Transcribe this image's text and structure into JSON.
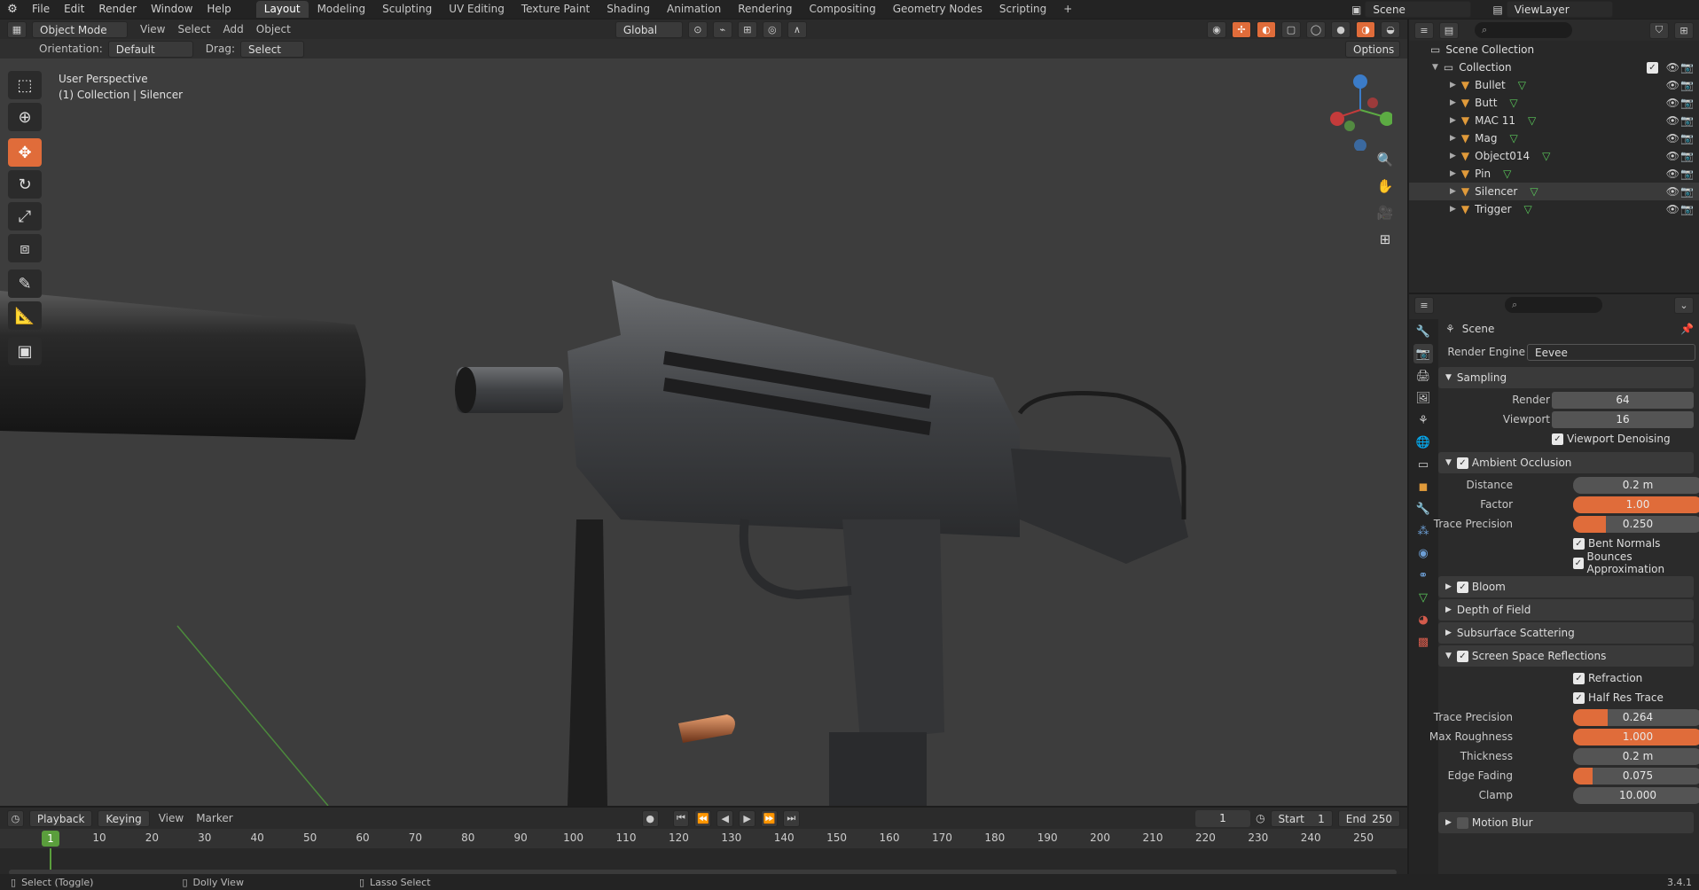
{
  "topbar": {
    "menus": [
      "File",
      "Edit",
      "Render",
      "Window",
      "Help"
    ],
    "workspaces": [
      "Layout",
      "Modeling",
      "Sculpting",
      "UV Editing",
      "Texture Paint",
      "Shading",
      "Animation",
      "Rendering",
      "Compositing",
      "Geometry Nodes",
      "Scripting"
    ],
    "active_workspace": "Layout",
    "scene_name": "Scene",
    "view_layer": "ViewLayer"
  },
  "viewport_header": {
    "mode": "Object Mode",
    "menus": [
      "View",
      "Select",
      "Add",
      "Object"
    ],
    "transform": "Global",
    "options": "Options"
  },
  "tool_settings": {
    "orientation_label": "Orientation:",
    "orientation_value": "Default",
    "drag_label": "Drag:",
    "drag_value": "Select Box"
  },
  "viewport": {
    "perspective": "User Perspective",
    "collection_info": "(1) Collection | Silencer"
  },
  "outliner": {
    "root": "Scene Collection",
    "collection": "Collection",
    "objects": [
      "Bullet",
      "Butt",
      "MAC 11",
      "Mag",
      "Object014",
      "Pin",
      "Silencer",
      "Trigger"
    ],
    "selected": "Silencer"
  },
  "properties": {
    "context": "Scene",
    "render_engine_label": "Render Engine",
    "render_engine": "Eevee",
    "sampling": {
      "title": "Sampling",
      "render_label": "Render",
      "render": "64",
      "viewport_label": "Viewport",
      "viewport": "16",
      "denoise": "Viewport Denoising"
    },
    "ao": {
      "title": "Ambient Occlusion",
      "distance_label": "Distance",
      "distance": "0.2 m",
      "factor_label": "Factor",
      "factor": "1.00",
      "factor_fill": 1.0,
      "trace_label": "Trace Precision",
      "trace": "0.250",
      "trace_fill": 0.25,
      "bent": "Bent Normals",
      "bounces": "Bounces Approximation"
    },
    "bloom": "Bloom",
    "dof": "Depth of Field",
    "sss": "Subsurface Scattering",
    "ssr": {
      "title": "Screen Space Reflections",
      "refraction": "Refraction",
      "half_res": "Half Res Trace",
      "trace_label": "Trace Precision",
      "trace": "0.264",
      "trace_fill": 0.264,
      "roughness_label": "Max Roughness",
      "roughness": "1.000",
      "roughness_fill": 1.0,
      "thickness_label": "Thickness",
      "thickness": "0.2 m",
      "edge_label": "Edge Fading",
      "edge": "0.075",
      "edge_fill": 0.15,
      "clamp_label": "Clamp",
      "clamp": "10.000"
    },
    "motion_blur": "Motion Blur"
  },
  "timeline": {
    "menus": [
      "Playback",
      "Keying",
      "View",
      "Marker"
    ],
    "current_frame": "1",
    "start_label": "Start",
    "start": "1",
    "end_label": "End",
    "end": "250",
    "ticks": [
      "10",
      "20",
      "30",
      "40",
      "50",
      "60",
      "70",
      "80",
      "90",
      "100",
      "110",
      "120",
      "130",
      "140",
      "150",
      "160",
      "170",
      "180",
      "190",
      "200",
      "210",
      "220",
      "230",
      "240",
      "250"
    ]
  },
  "statusbar": {
    "select": "Select (Toggle)",
    "dolly": "Dolly View",
    "lasso": "Lasso Select",
    "version": "3.4.1"
  },
  "colors": {
    "accent": "#e06c3a",
    "selected_row": "#334d80",
    "bg_viewport": "#3d3d3d"
  }
}
